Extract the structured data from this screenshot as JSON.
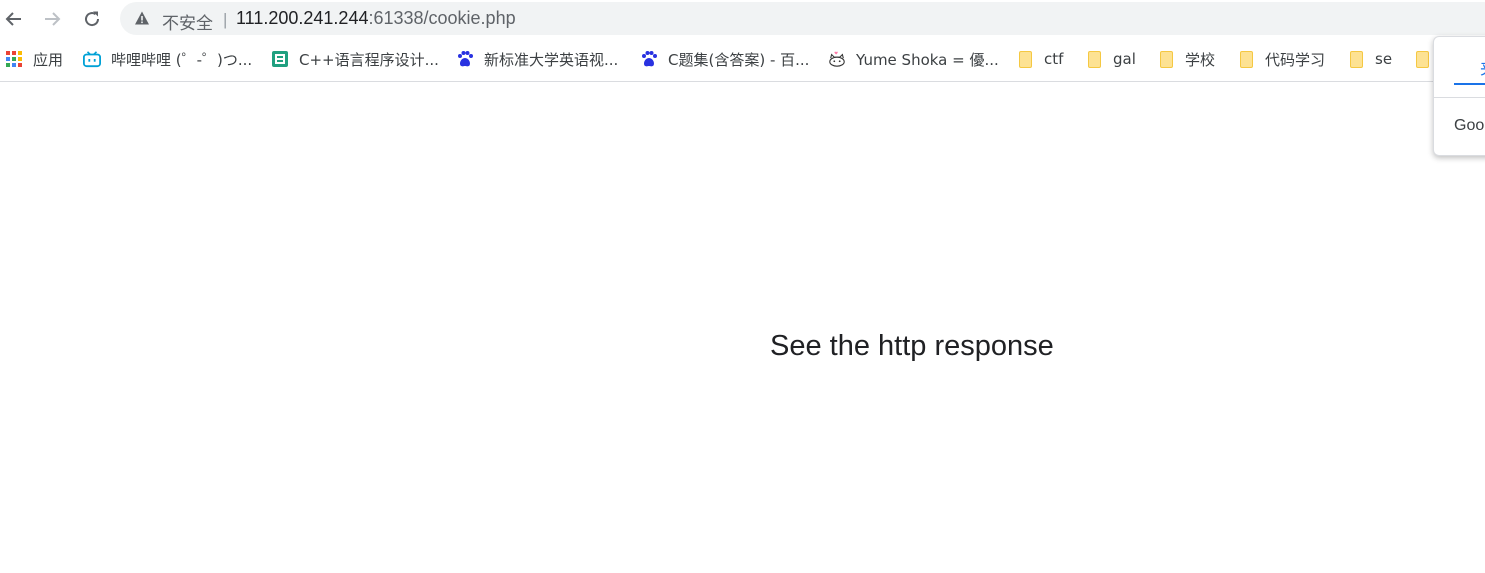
{
  "omnibox": {
    "security_label": "不安全",
    "separator": "|",
    "url_host": "111.200.241.244",
    "url_rest": ":61338/cookie.php"
  },
  "bookmarks": [
    {
      "label": "应用",
      "icon": "apps-grid-icon"
    },
    {
      "label": "哔哩哔哩 (゜-゜)つ...",
      "icon": "bilibili-icon"
    },
    {
      "label": "C++语言程序设计...",
      "icon": "site-icon"
    },
    {
      "label": "新标准大学英语视...",
      "icon": "baidu-paw-icon"
    },
    {
      "label": "C题集(含答案) - 百...",
      "icon": "baidu-paw-icon"
    },
    {
      "label": "Yume Shoka = 優...",
      "icon": "cat-icon"
    },
    {
      "label": "ctf",
      "icon": "folder-icon"
    },
    {
      "label": "gal",
      "icon": "folder-icon"
    },
    {
      "label": "学校",
      "icon": "folder-icon"
    },
    {
      "label": "代码学习",
      "icon": "folder-icon"
    },
    {
      "label": "se",
      "icon": "folder-icon"
    }
  ],
  "page": {
    "message": "See the http response"
  },
  "popup": {
    "tab_label": "夹",
    "engine_label": "Goo"
  },
  "colors": {
    "accent": "#1a73e8",
    "omnibox_bg": "#f1f3f4",
    "folder": "#fde293"
  }
}
